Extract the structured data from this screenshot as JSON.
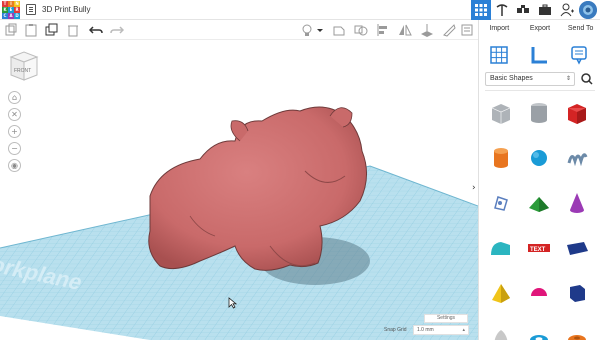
{
  "app": {
    "document_title": "3D Print Bully",
    "logo_letters": [
      "T",
      "I",
      "N",
      "K",
      "E",
      "R",
      "C",
      "A",
      "D"
    ]
  },
  "colors": {
    "accent_blue": "#2b80d6",
    "bulldog": "#c96a6a",
    "workplane": "#b9e0ee",
    "grid_line": "#8fcbe0"
  },
  "topbar": {
    "icons": [
      "grid-view-icon",
      "pickaxe-icon",
      "codeblocks-icon",
      "briefcase-icon",
      "add-user-icon",
      "avatar-icon"
    ]
  },
  "toolbar": {
    "icons": [
      "copy-icon",
      "paste-icon",
      "duplicate-icon",
      "delete-icon",
      "undo-icon",
      "redo-icon",
      "light-icon",
      "chevron-down-icon",
      "shape-icon",
      "group-icon",
      "align-icon",
      "flip-icon",
      "workplane-icon",
      "ruler-icon",
      "notes-icon"
    ]
  },
  "viewport": {
    "viewcube_label": "FRONT",
    "workplane_label": "Workplane",
    "settings_label": "Settings",
    "snap_grid_label": "Snap Grid",
    "snap_grid_value": "1.0 mm",
    "nav_buttons": [
      "home-view-icon",
      "fit-view-icon",
      "zoom-in-icon",
      "zoom-out-icon",
      "perspective-icon"
    ]
  },
  "panel": {
    "actions": [
      "Import",
      "Export",
      "Send To"
    ],
    "category": "Basic Shapes",
    "shapes": [
      {
        "name": "box-hole",
        "color": "#9aa0a6"
      },
      {
        "name": "cylinder-hole",
        "color": "#9aa0a6"
      },
      {
        "name": "box",
        "color": "#d42424"
      },
      {
        "name": "cylinder",
        "color": "#e8751f"
      },
      {
        "name": "sphere",
        "color": "#1a9bd6"
      },
      {
        "name": "scribble",
        "color": "#6c8aa8"
      },
      {
        "name": "shape-generators",
        "color": "#5b7fbf"
      },
      {
        "name": "roof",
        "color": "#2b9b3a"
      },
      {
        "name": "cone",
        "color": "#9b3ab5"
      },
      {
        "name": "round-roof",
        "color": "#2bb5c0"
      },
      {
        "name": "text",
        "color": "#d42424"
      },
      {
        "name": "wedge",
        "color": "#1f3a8a"
      },
      {
        "name": "pyramid",
        "color": "#f0c419"
      },
      {
        "name": "half-sphere",
        "color": "#e0167a"
      },
      {
        "name": "polygon",
        "color": "#1f3a8a"
      },
      {
        "name": "paraboloid",
        "color": "#c8c8c8"
      },
      {
        "name": "torus",
        "color": "#1a9bd6"
      },
      {
        "name": "tube",
        "color": "#e8751f"
      }
    ]
  }
}
